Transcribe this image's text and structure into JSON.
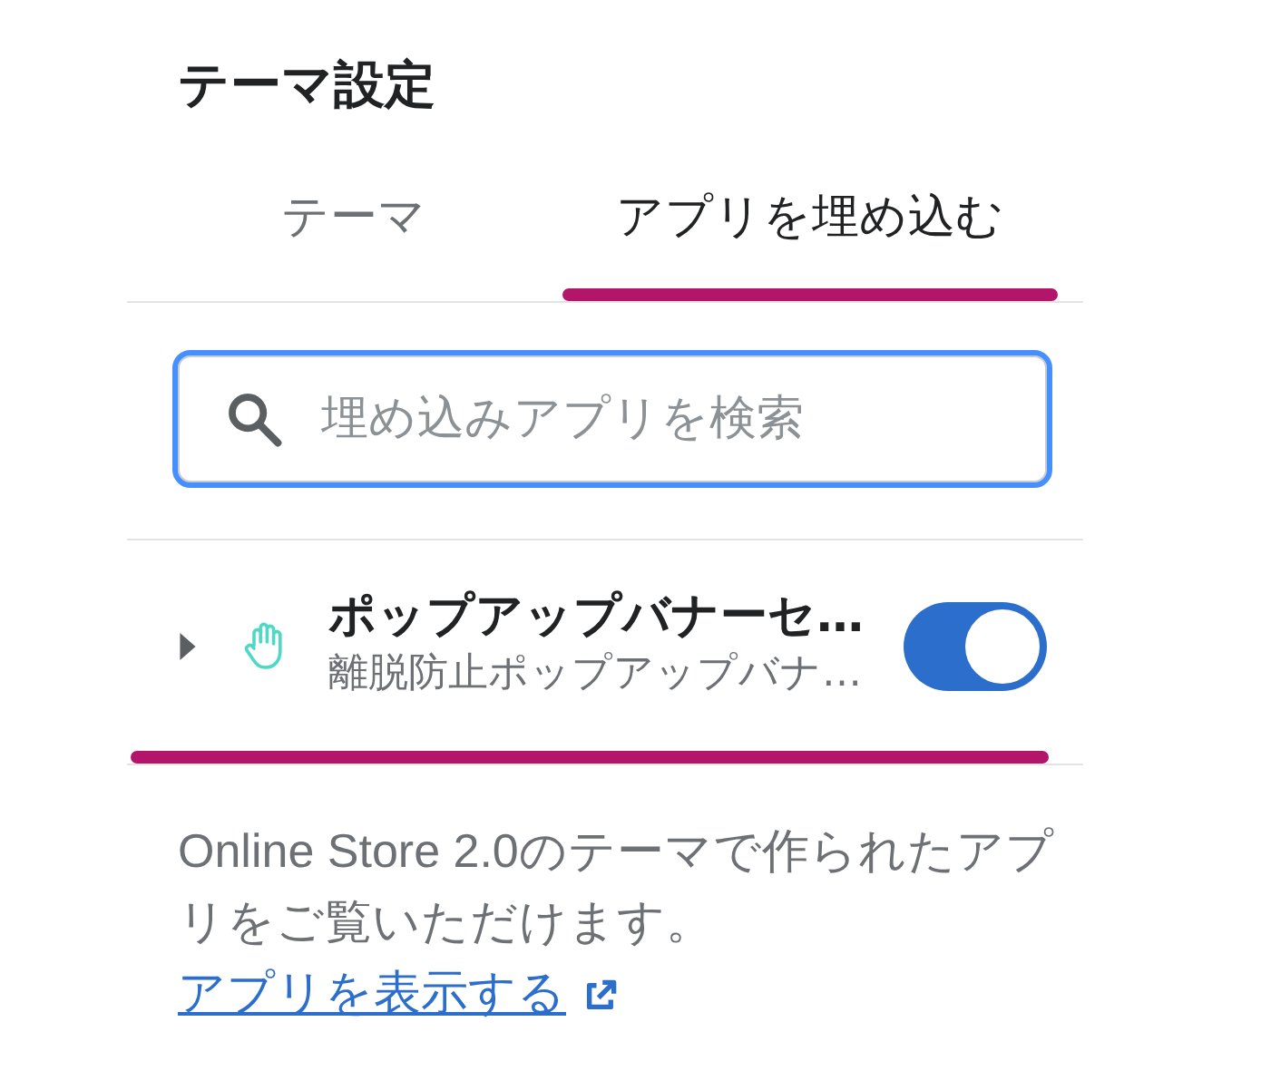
{
  "panel": {
    "title": "テーマ設定"
  },
  "tabs": [
    {
      "label": "テーマ",
      "selected": false
    },
    {
      "label": "アプリを埋め込む",
      "selected": true
    }
  ],
  "search": {
    "placeholder": "埋め込みアプリを検索",
    "focused": true
  },
  "app_embeds": [
    {
      "name": "ポップアップバナーセ…",
      "description": "離脱防止ポップアップバナ…",
      "expanded": false,
      "on": true,
      "highlighted": true
    }
  ],
  "footer": {
    "text": "Online Store 2.0のテーマで作られたアプリをご覧いただけます。",
    "link": "アプリを表示する"
  }
}
